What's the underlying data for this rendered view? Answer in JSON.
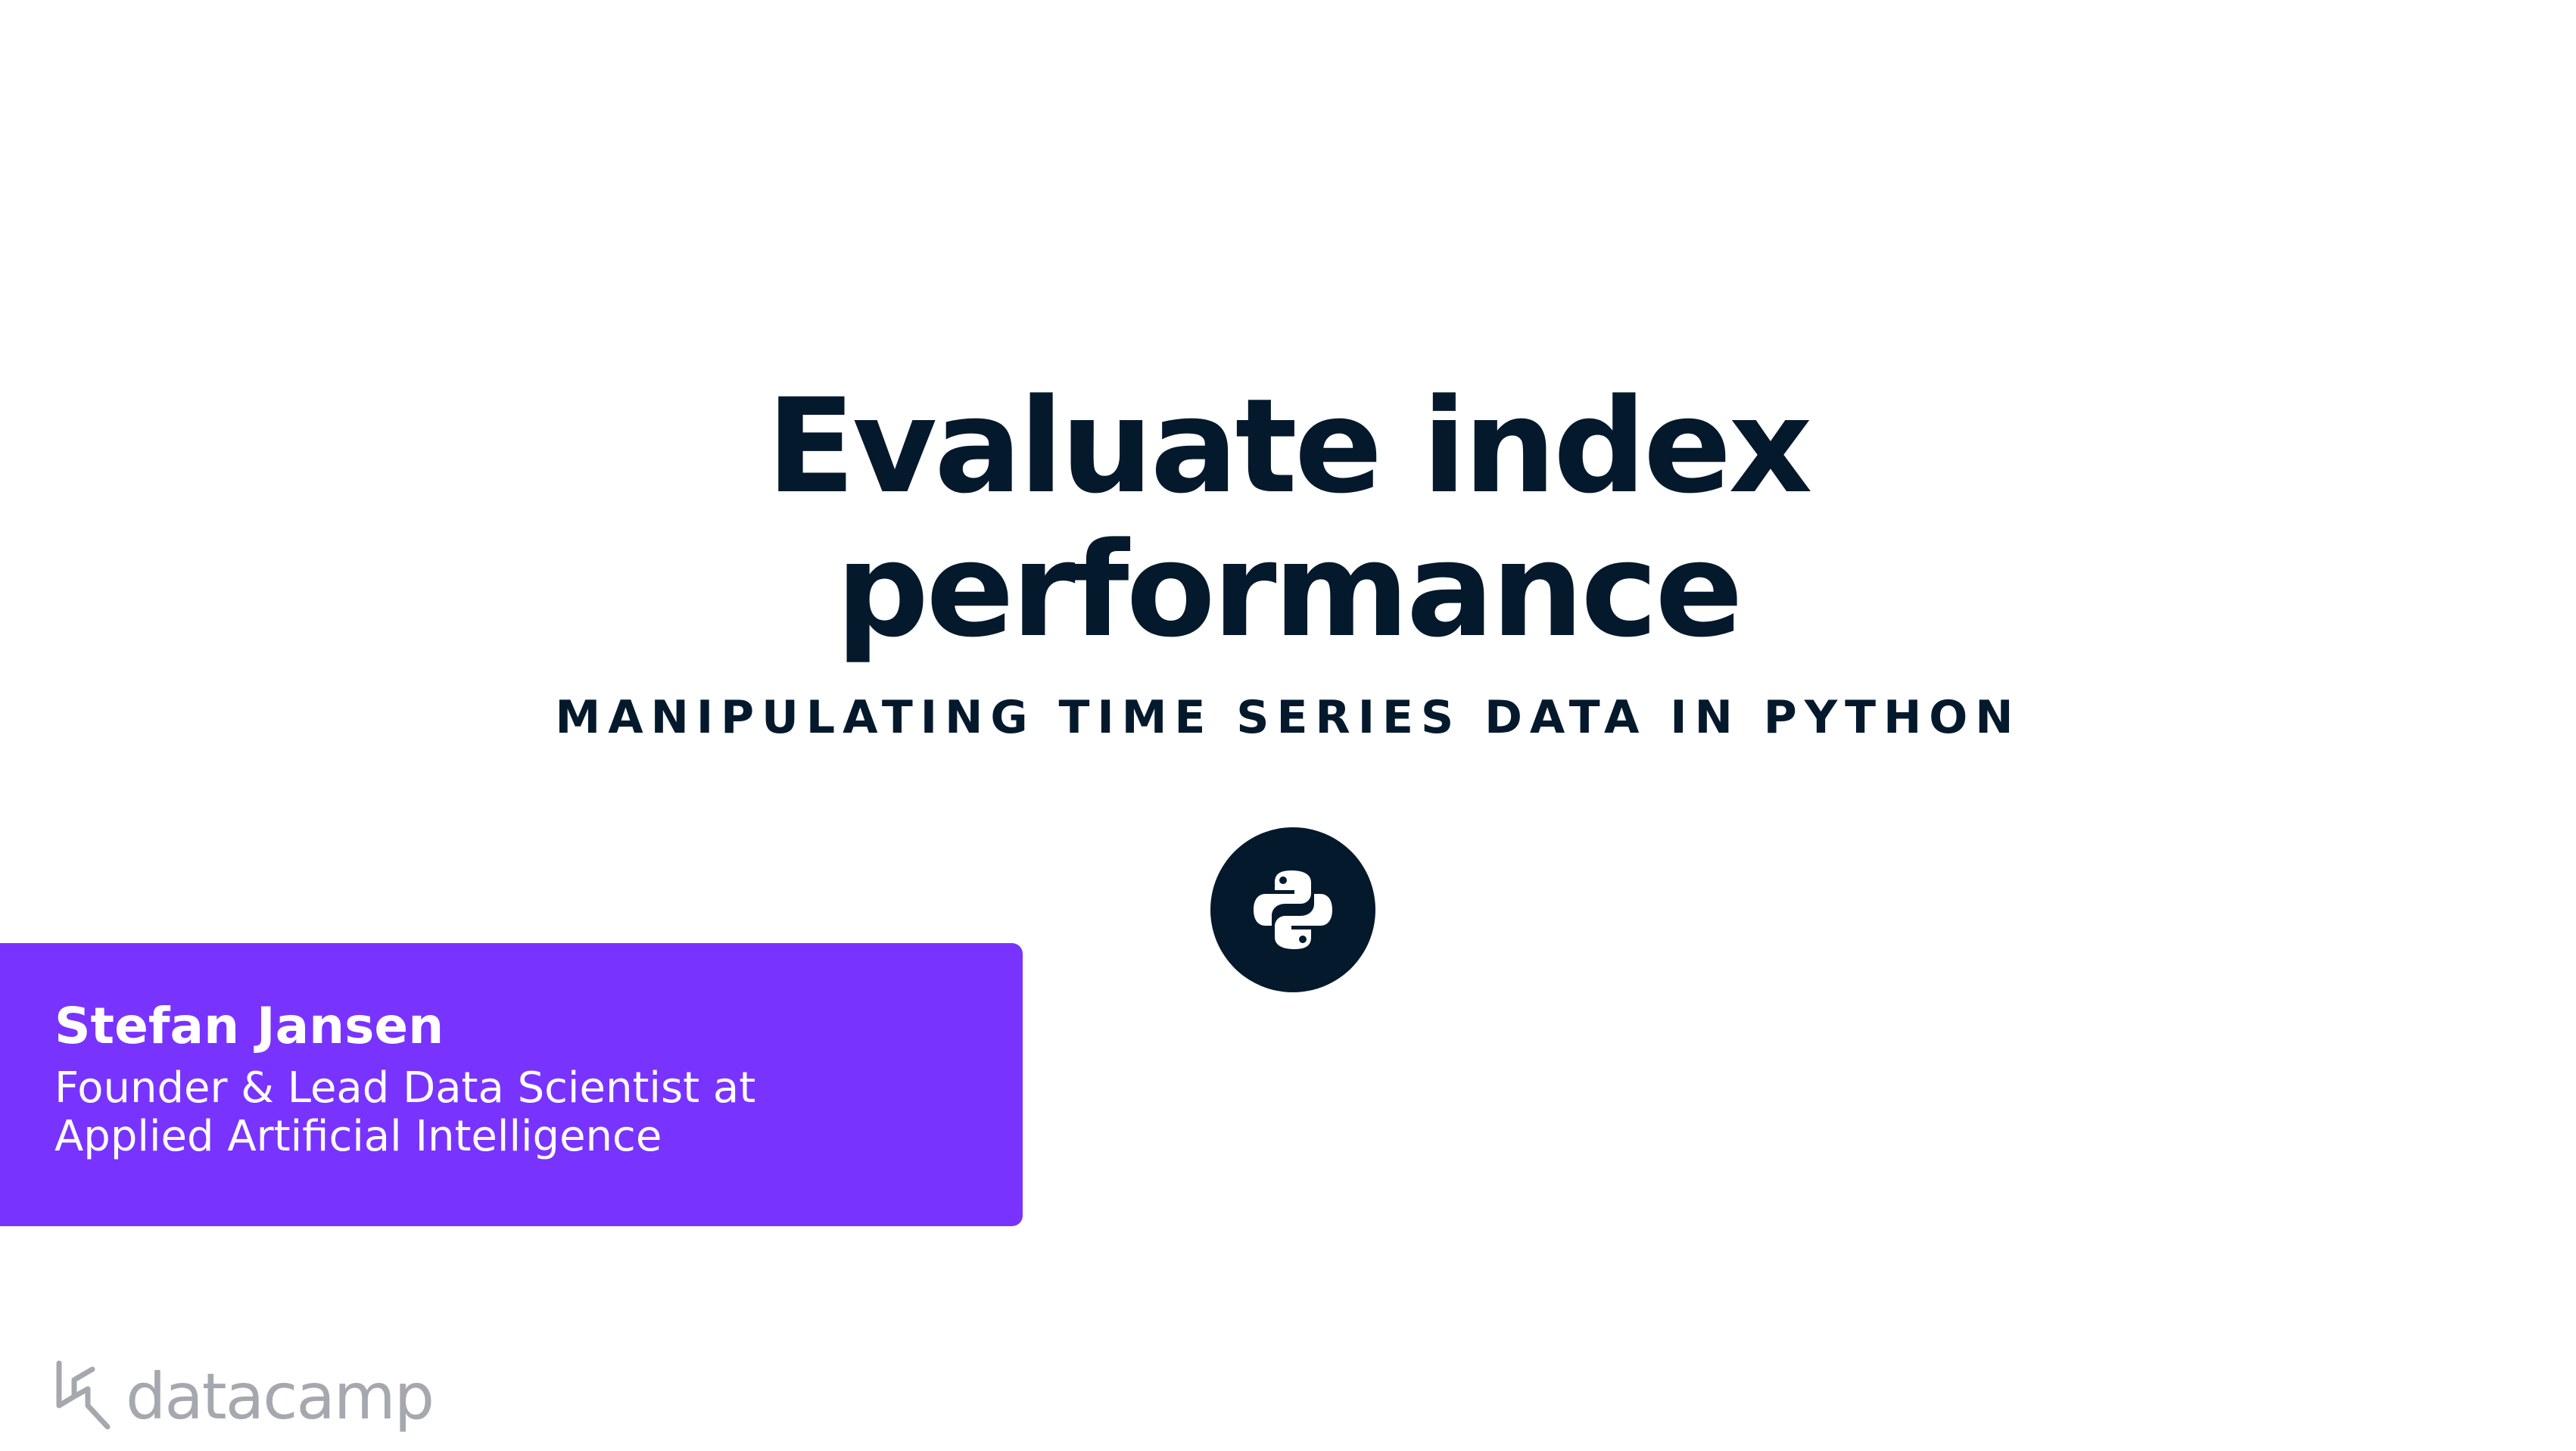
{
  "slide": {
    "title_lines": [
      "Evaluate index",
      "performance"
    ],
    "course": "MANIPULATING TIME SERIES DATA IN PYTHON"
  },
  "badge": {
    "icon": "python-logo-icon",
    "background": "#05192d",
    "foreground": "#ffffff"
  },
  "instructor": {
    "name": "Stefan Jansen",
    "role_lines": [
      "Founder & Lead Data Scientist at",
      "Applied Artificial Intelligence"
    ],
    "card_color": "#7933ff"
  },
  "brand": {
    "name": "datacamp",
    "icon": "datacamp-logo-icon",
    "color": "#a5a8ae"
  },
  "colors": {
    "text": "#05192d",
    "background": "#ffffff"
  }
}
